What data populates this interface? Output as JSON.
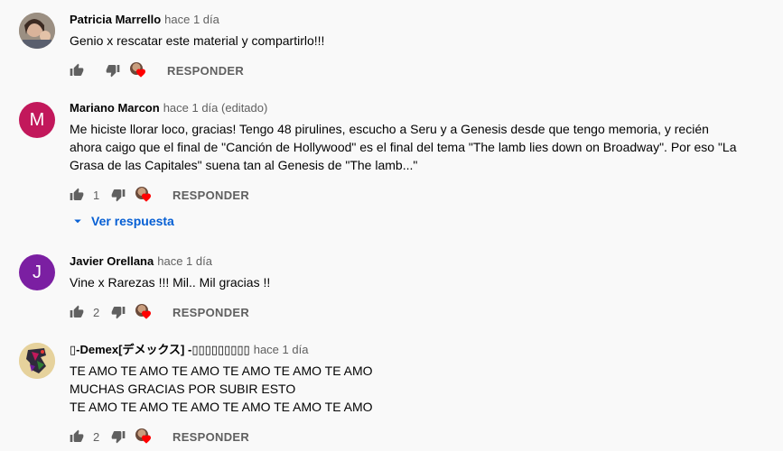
{
  "comments": [
    {
      "author": "Patricia Marrello",
      "time": "hace 1 día",
      "lines": [
        "Genio x rescatar este material y compartirlo!!!"
      ],
      "likes": "",
      "reply_label": "RESPONDER",
      "avatar_letter": ""
    },
    {
      "author": "Mariano Marcon",
      "time": "hace 1 día (editado)",
      "lines": [
        "Me hiciste llorar loco, gracias! Tengo 48 pirulines, escucho a Seru y a Genesis desde que tengo memoria, y recién",
        "ahora caigo que el final de \"Canción de Hollywood\" es el final del tema \"The lamb lies down on Broadway\". Por eso \"La",
        "Grasa de las Capitales\" suena tan al Genesis de \"The lamb...\""
      ],
      "likes": "1",
      "reply_label": "RESPONDER",
      "avatar_letter": "M",
      "avatar_color": "#c2185b",
      "view_replies": "Ver respuesta"
    },
    {
      "author": "Javier Orellana",
      "time": "hace 1 día",
      "lines": [
        "Vine x Rarezas !!! Mil.. Mil gracias !!"
      ],
      "likes": "2",
      "reply_label": "RESPONDER",
      "avatar_letter": "J",
      "avatar_color": "#7b1fa2"
    },
    {
      "author": "▯-Demex[デメックス] -▯▯▯▯▯▯▯▯▯",
      "time": "hace 1 día",
      "lines": [
        "TE AMO TE AMO TE AMO TE AMO TE AMO TE AMO",
        "MUCHAS GRACIAS POR SUBIR ESTO",
        "TE AMO TE AMO TE AMO TE AMO TE AMO TE AMO"
      ],
      "likes": "2",
      "reply_label": "RESPONDER",
      "avatar_letter": ""
    }
  ],
  "colors": {
    "link_blue": "#065fd4",
    "muted": "#606060",
    "heart": "#ff0000"
  },
  "icons": {
    "like": "thumb-up-icon",
    "dislike": "thumb-down-icon",
    "creator_heart": "creator-heart-icon",
    "expand": "caret-down-icon"
  }
}
